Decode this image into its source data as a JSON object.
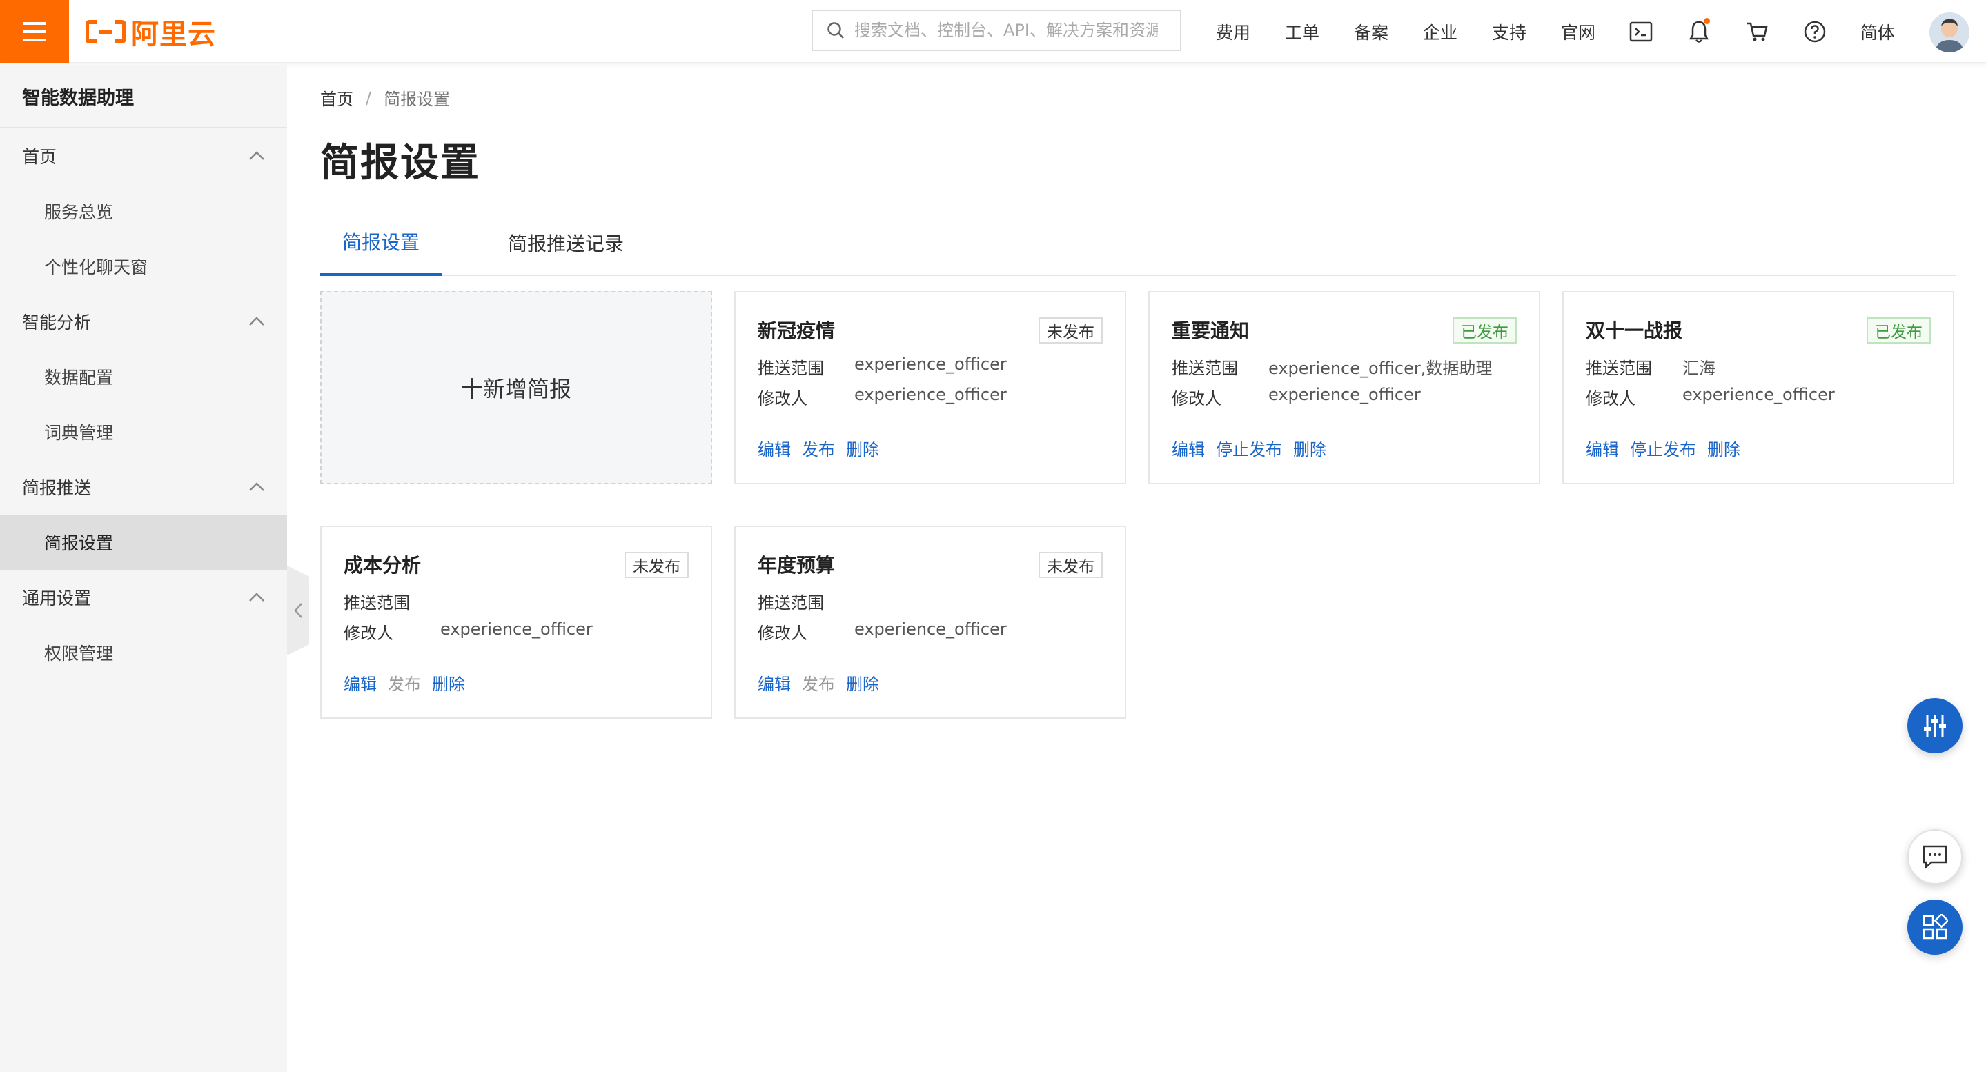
{
  "header": {
    "logo_text": "阿里云",
    "search_placeholder": "搜索文档、控制台、API、解决方案和资源",
    "nav": [
      "费用",
      "工单",
      "备案",
      "企业",
      "支持",
      "官网"
    ],
    "lang": "简体"
  },
  "sidebar": {
    "title": "智能数据助理",
    "groups": [
      {
        "label": "首页",
        "items": [
          "服务总览",
          "个性化聊天窗"
        ]
      },
      {
        "label": "智能分析",
        "items": [
          "数据配置",
          "词典管理"
        ]
      },
      {
        "label": "简报推送",
        "items": [
          "简报设置"
        ]
      },
      {
        "label": "通用设置",
        "items": [
          "权限管理"
        ]
      }
    ],
    "active_item": "简报设置"
  },
  "breadcrumb": {
    "home": "首页",
    "sep": "/",
    "current": "简报设置"
  },
  "page_title": "简报设置",
  "tabs": [
    {
      "label": "简报设置",
      "active": true
    },
    {
      "label": "简报推送记录",
      "active": false
    }
  ],
  "add_card": {
    "label": "十新增简报"
  },
  "field_labels": {
    "scope": "推送范围",
    "modifier": "修改人"
  },
  "cards": [
    {
      "title": "新冠疫情",
      "status": "未发布",
      "scope": "experience_officer",
      "modifier": "experience_officer",
      "actions": [
        "编辑",
        "发布",
        "删除"
      ],
      "publish_enabled": true
    },
    {
      "title": "重要通知",
      "status": "已发布",
      "scope": "experience_officer,数据助理",
      "modifier": "experience_officer",
      "actions": [
        "编辑",
        "停止发布",
        "删除"
      ],
      "publish_enabled": true
    },
    {
      "title": "双十一战报",
      "status": "已发布",
      "scope": "汇海",
      "modifier": "experience_officer",
      "actions": [
        "编辑",
        "停止发布",
        "删除"
      ],
      "publish_enabled": true
    },
    {
      "title": "成本分析",
      "status": "未发布",
      "scope": "",
      "modifier": "experience_officer",
      "actions": [
        "编辑",
        "发布",
        "删除"
      ],
      "publish_enabled": false
    },
    {
      "title": "年度预算",
      "status": "未发布",
      "scope": "",
      "modifier": "experience_officer",
      "actions": [
        "编辑",
        "发布",
        "删除"
      ],
      "publish_enabled": false
    }
  ],
  "colors": {
    "brand": "#ff6a00",
    "link": "#1a66c8",
    "published": "#3f9b3f"
  }
}
